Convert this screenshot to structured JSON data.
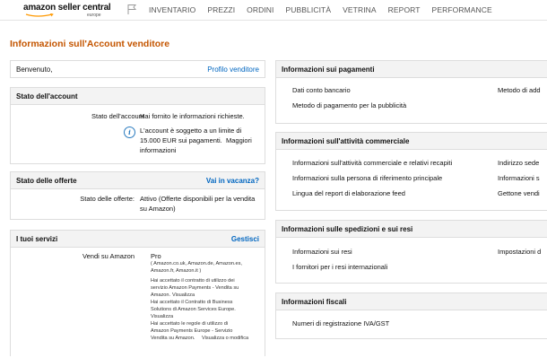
{
  "header": {
    "logo_main": "amazon seller central",
    "logo_sub": "europe",
    "nav": [
      "INVENTARIO",
      "PREZZI",
      "ORDINI",
      "PUBBLICITÀ",
      "VETRINA",
      "REPORT",
      "PERFORMANCE"
    ]
  },
  "page_title": "Informazioni sull'Account venditore",
  "welcome": {
    "text": "Benvenuto,",
    "link": "Profilo venditore"
  },
  "account_status": {
    "title": "Stato dell'account",
    "label": "Stato dell'account",
    "value": "Hai fornito le informazioni richieste.",
    "notice_line1": "L'account è soggetto a un limite di",
    "notice_line2": "15.000 EUR sui pagamenti.",
    "notice_link1": "Maggiori",
    "notice_link2": "informazioni"
  },
  "offers": {
    "title": "Stato delle offerte",
    "action": "Vai in vacanza?",
    "label": "Stato delle offerte:",
    "value1": "Attivo (Offerte disponibili per la vendita",
    "value2": "su Amazon)"
  },
  "services": {
    "title": "I tuoi servizi",
    "action": "Gestisci",
    "label": "Vendi su Amazon",
    "plan": "Pro",
    "marketplaces1": "( Amazon.co.uk, Amazon.de, Amazon.es,",
    "marketplaces2": "Amazon.fr, Amazon.it )",
    "t1": "Hai accettato il contratto di utilizzo dei",
    "t2": "servizio Amazon Payments - Vendita su",
    "t3": "Amazon.",
    "t3_link": "Visualizza",
    "t4": "Hai accettato il Contratto di Business",
    "t5": "Solutions di Amazon Services Europe.",
    "t6_link": "Visualizza",
    "t7": "Hai accettato le regole di utilizzo di",
    "t8": "Amazon Payments Europe - Servizio",
    "t9": "Vendita su Amazon.",
    "t9_link": "Visualizza o modifica"
  },
  "payments": {
    "title": "Informazioni sui pagamenti",
    "links": [
      "Dati conto bancario",
      "Metodo di pagamento per la pubblicità"
    ],
    "right_link": "Metodo di add"
  },
  "business": {
    "title": "Informazioni sull'attività commerciale",
    "links": [
      "Informazioni sull'attività commerciale e relativi recapiti",
      "Informazioni sulla persona di riferimento principale",
      "Lingua del report di elaborazione feed"
    ],
    "right_links": [
      "Indirizzo sede",
      "Informazioni s",
      "Gettone vendi"
    ]
  },
  "shipping": {
    "title": "Informazioni sulle spedizioni e sui resi",
    "links": [
      "Informazioni sui resi",
      "I fornitori per i resi internazionali"
    ],
    "right_link": "Impostazioni d"
  },
  "tax": {
    "title": "Informazioni fiscali",
    "links": [
      "Numeri di registrazione IVA/GST"
    ]
  }
}
